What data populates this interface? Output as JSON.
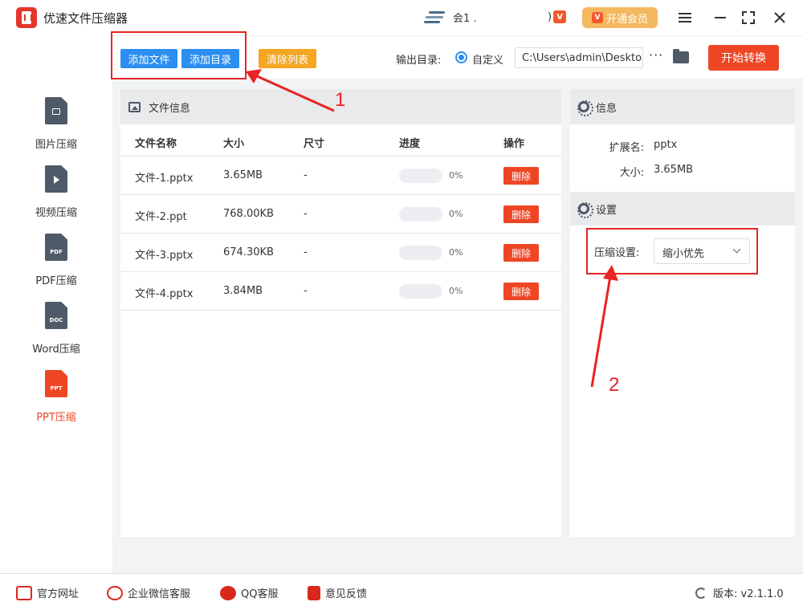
{
  "titlebar": {
    "app_title": "优速文件压缩器",
    "user_name": "会1  .",
    "vip_button": "开通会员",
    "vip_badge": "V"
  },
  "toolbar": {
    "add_file": "添加文件",
    "add_dir": "添加目录",
    "clear_list": "清除列表",
    "output_label": "输出目录:",
    "radio_label": "自定义",
    "output_path": "C:\\Users\\admin\\Deskto",
    "more": "···",
    "start": "开始转换"
  },
  "sidebar": {
    "items": [
      {
        "label": "图片压缩",
        "tag": ""
      },
      {
        "label": "视频压缩",
        "tag": ""
      },
      {
        "label": "PDF压缩",
        "tag": "PDF"
      },
      {
        "label": "Word压缩",
        "tag": "DOC"
      },
      {
        "label": "PPT压缩",
        "tag": "PPT"
      }
    ]
  },
  "file_panel": {
    "title": "文件信息",
    "columns": [
      "文件名称",
      "大小",
      "尺寸",
      "进度",
      "操作"
    ],
    "rows": [
      {
        "name": "文件-1.pptx",
        "size": "3.65MB",
        "dim": "-",
        "progress_text": "0%",
        "progress": 0,
        "action": "删除"
      },
      {
        "name": "文件-2.ppt",
        "size": "768.00KB",
        "dim": "-",
        "progress_text": "0%",
        "progress": 0,
        "action": "删除"
      },
      {
        "name": "文件-3.pptx",
        "size": "674.30KB",
        "dim": "-",
        "progress_text": "0%",
        "progress": 0,
        "action": "删除"
      },
      {
        "name": "文件-4.pptx",
        "size": "3.84MB",
        "dim": "-",
        "progress_text": "0%",
        "progress": 0,
        "action": "删除"
      }
    ]
  },
  "info_panel": {
    "title": "信息",
    "ext_label": "扩展名:",
    "ext_value": "pptx",
    "size_label": "大小:",
    "size_value": "3.65MB"
  },
  "settings_panel": {
    "title": "设置",
    "compress_label": "压缩设置:",
    "compress_value": "缩小优先"
  },
  "footer": {
    "website": "官方网址",
    "wechat": "企业微信客服",
    "qq": "QQ客服",
    "feedback": "意见反馈",
    "version": "版本: v2.1.1.0"
  },
  "annotations": {
    "one": "1",
    "two": "2"
  },
  "colors": {
    "accent_blue": "#2b8ef0",
    "accent_red": "#ee4624",
    "accent_orange": "#f5a623",
    "annotation_red": "#e82424"
  }
}
